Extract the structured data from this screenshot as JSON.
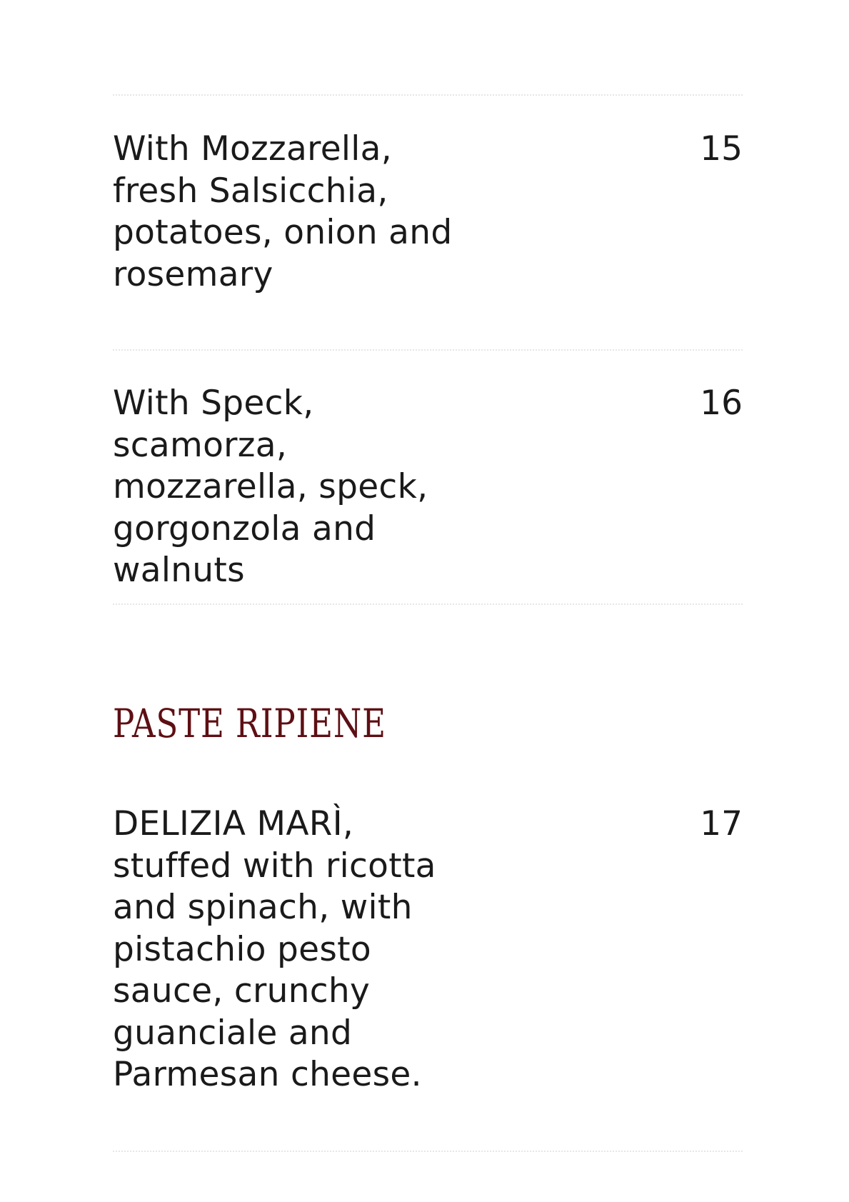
{
  "items_before": [
    {
      "description": "With Mozzarella,\nfresh Salsicchia,\npotatoes, onion and\nrosemary",
      "price": "15"
    },
    {
      "description": "With Speck,\nscamorza,\nmozzarella, speck,\ngorgonzola and\nwalnuts",
      "price": "16"
    }
  ],
  "section": {
    "title": "PASTE RIPIENE",
    "items": [
      {
        "description": "DELIZIA MARÌ,\nstuffed with ricotta\nand spinach, with\npistachio pesto\nsauce, crunchy\nguanciale and\nParmesan cheese.",
        "price": "17"
      }
    ]
  },
  "colors": {
    "text": "#1a1a1a",
    "section_title": "#5e0f14",
    "divider": "#e6e6e6"
  }
}
